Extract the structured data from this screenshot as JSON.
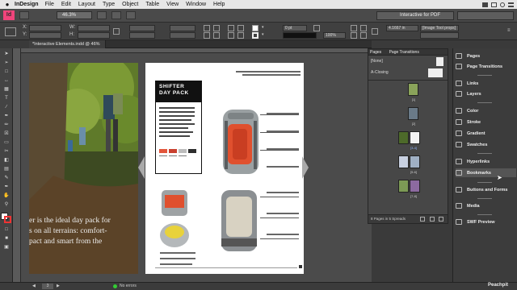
{
  "menubar": {
    "apple": "",
    "app": "InDesign",
    "items": [
      "File",
      "Edit",
      "Layout",
      "Type",
      "Object",
      "Table",
      "View",
      "Window",
      "Help"
    ]
  },
  "appbar": {
    "logo": "Id",
    "zoom": "46.3%",
    "workspace": "Interactive for PDF"
  },
  "control": {
    "x": "",
    "y": "",
    "w": "",
    "h": "",
    "stroke": "0 pt",
    "pct": "100%",
    "right_value": "4.1667 in",
    "frame_fit": "[Image Tool props]"
  },
  "document_tab": {
    "title": "*Interactive Elements.indd @ 46%"
  },
  "spread": {
    "left_page_text": [
      "er is the ideal day pack for",
      "s on all terrains: comfort-",
      "pact and smart from the"
    ],
    "card_title": [
      "SHIFTER",
      "DAY PACK"
    ],
    "swatches": [
      "#e2553b",
      "#c9402f",
      "#bdbdbd",
      "#2e2e2e"
    ]
  },
  "pages_panel": {
    "tabs": [
      "Pages",
      "Page Transitions"
    ],
    "masters": [
      "[None]",
      "A-Closing"
    ],
    "page_labels": [
      "[1]",
      "[2]",
      "[3-4]",
      "[5-6]",
      "[7-8]"
    ],
    "footer": "8 Pages in 5 Spreads"
  },
  "dock": {
    "items": [
      "Pages",
      "Page Transitions",
      "Links",
      "Layers",
      "Color",
      "Stroke",
      "Gradient",
      "Swatches",
      "Hyperlinks",
      "Bookmarks",
      "Buttons and Forms",
      "Media",
      "SWF Preview"
    ]
  },
  "status": {
    "page": "3",
    "errors": "No errors"
  },
  "watermark": "Peachpit"
}
